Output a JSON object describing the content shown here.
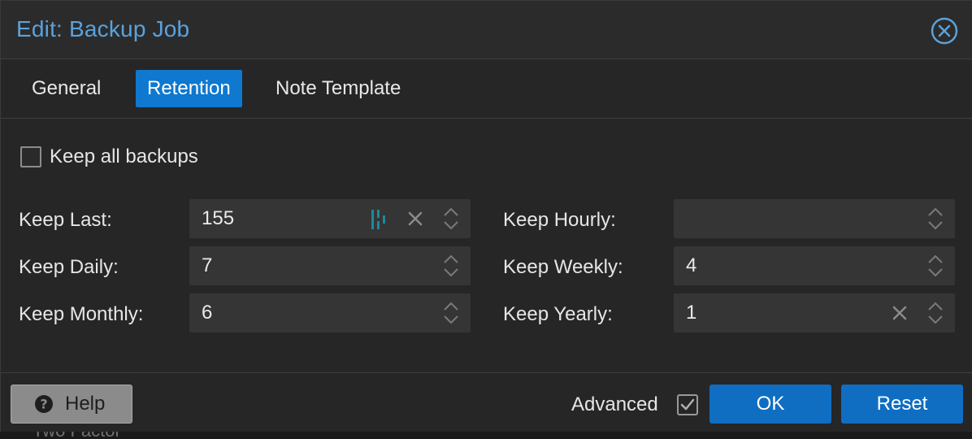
{
  "dialog": {
    "title": "Edit: Backup Job"
  },
  "tabs": [
    {
      "label": "General",
      "active": false
    },
    {
      "label": "Retention",
      "active": true
    },
    {
      "label": "Note Template",
      "active": false
    }
  ],
  "retention": {
    "keep_all": {
      "label": "Keep all backups",
      "checked": false
    },
    "fields": {
      "keep_last": {
        "label": "Keep Last:",
        "value": "155"
      },
      "keep_daily": {
        "label": "Keep Daily:",
        "value": "7"
      },
      "keep_monthly": {
        "label": "Keep Monthly:",
        "value": "6"
      },
      "keep_hourly": {
        "label": "Keep Hourly:",
        "value": ""
      },
      "keep_weekly": {
        "label": "Keep Weekly:",
        "value": "4"
      },
      "keep_yearly": {
        "label": "Keep Yearly:",
        "value": "1"
      }
    }
  },
  "footer": {
    "help_label": "Help",
    "advanced_label": "Advanced",
    "advanced_checked": true,
    "ok_label": "OK",
    "reset_label": "Reset"
  },
  "background": {
    "partial_text": "Two Factor"
  },
  "colors": {
    "accent": "#0f78cf",
    "title": "#5aa2dc",
    "background": "#262626",
    "field": "#353535"
  },
  "icons": {
    "close": "close-circle-icon",
    "spinner": "spinner-updown-icon",
    "clear": "clear-x-icon",
    "password_manager": "password-manager-icon",
    "help": "question-circle-icon",
    "advanced_check": "checkbox-checked-icon"
  }
}
